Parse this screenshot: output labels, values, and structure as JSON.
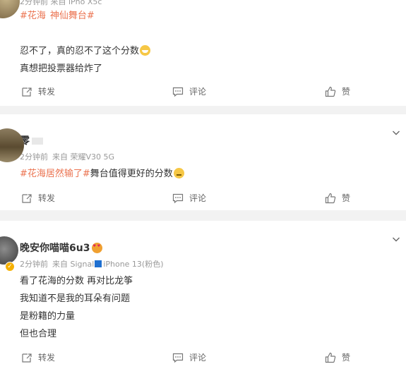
{
  "post1": {
    "meta": "2分钟前 来自 iPho X5c",
    "topics": [
      "#花海",
      "神仙舞台#"
    ],
    "lines": [
      "忍不了，真的忍不了这个分数",
      "真想把投票器给炸了"
    ]
  },
  "post2": {
    "name": "零",
    "meta_time": "2分钟前",
    "meta_source": "来自 荣耀V30 5G",
    "topic": "#花海居然输了#",
    "line_rest": "舞台值得更好的分数"
  },
  "post3": {
    "name": "晚安你喵喵6u3",
    "meta_time": "2分钟前",
    "meta_source_prefix": "来自 Signal",
    "meta_source_suffix": "iPhone 13(粉色)",
    "lines": [
      "看了花海的分数 再对比龙筝",
      "我知道不是我的耳朵有问题",
      "是粉籍的力量",
      "但也合理"
    ]
  },
  "actions": {
    "repost": "转发",
    "comment": "评论",
    "like": "赞"
  },
  "icons": [
    "repost-icon",
    "comment-icon",
    "like-icon",
    "chevron-down-icon"
  ],
  "colors": {
    "topic": "#eb7350",
    "meta": "#999999",
    "text": "#333333"
  }
}
